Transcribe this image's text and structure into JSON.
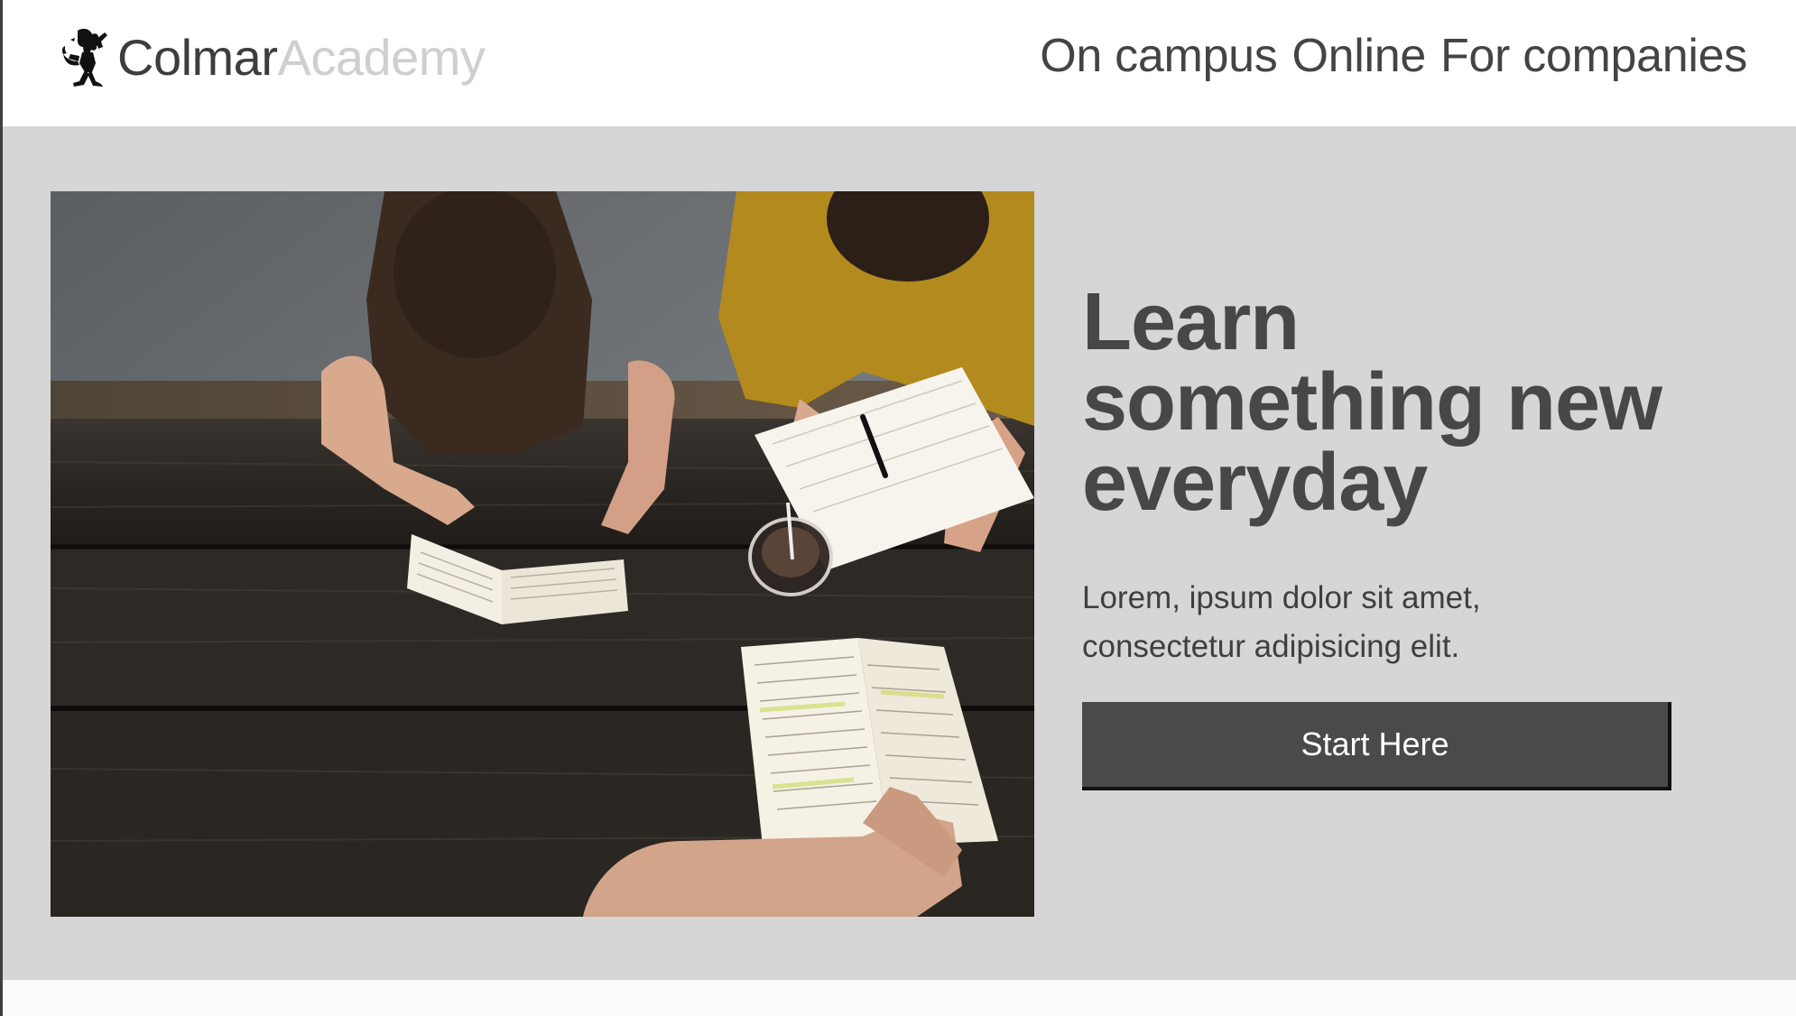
{
  "brand": {
    "name_primary": "Colmar",
    "name_secondary": "Academy",
    "logo_icon": "rampant-lion-icon"
  },
  "nav": {
    "items": [
      {
        "label": "On campus"
      },
      {
        "label": "Online"
      },
      {
        "label": "For companies"
      }
    ]
  },
  "hero": {
    "image": "students-studying-at-picnic-table-photo",
    "title": "Learn\nsomething new\neveryday",
    "subtitle": "Lorem, ipsum dolor sit amet, consectetur adipisicing elit.",
    "cta_label": "Start Here"
  },
  "colors": {
    "hero_background": "#d6d6d6",
    "button_background": "#4a4a4a",
    "text_dark": "#444444",
    "brand_secondary": "#cfcfcf"
  }
}
